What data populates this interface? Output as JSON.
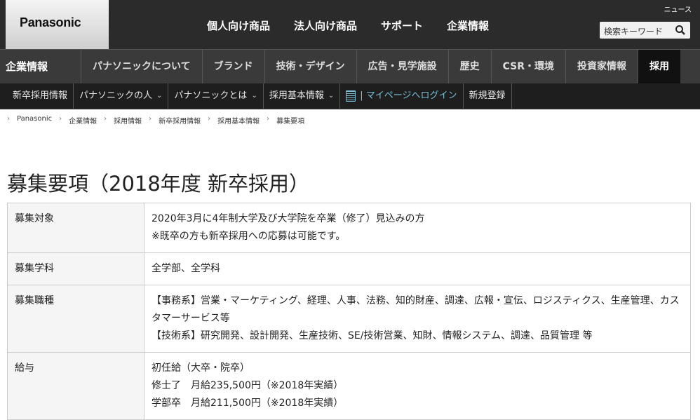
{
  "header": {
    "brand": "Panasonic",
    "news": "ニュース",
    "nav": [
      "個人向け商品",
      "法人向け商品",
      "サポート",
      "企業情報"
    ],
    "search_placeholder": "検索キーワード"
  },
  "secondary_nav": {
    "title": "企業情報",
    "items": [
      "パナソニックについて",
      "ブランド",
      "技術・デザイン",
      "広告・見学施設",
      "歴史",
      "CSR・環境",
      "投資家情報",
      "採用"
    ]
  },
  "tertiary_nav": {
    "items": [
      "新卒採用情報",
      "パナソニックの人",
      "パナソニックとは",
      "採用基本情報",
      "| マイページへログイン",
      "新規登録"
    ]
  },
  "breadcrumb": [
    "Panasonic",
    "企業情報",
    "採用情報",
    "新卒採用情報",
    "採用基本情報",
    "募集要項"
  ],
  "page_title": "募集要項（2018年度 新卒採用）",
  "table": [
    {
      "label": "募集対象",
      "lines": [
        "2020年3月に4年制大学及び大学院を卒業（修了）見込みの方",
        "※既卒の方も新卒採用への応募は可能です。"
      ]
    },
    {
      "label": "募集学科",
      "lines": [
        "全学部、全学科"
      ]
    },
    {
      "label": "募集職種",
      "lines": [
        "【事務系】営業・マーケティング、経理、人事、法務、知的財産、調達、広報・宣伝、ロジスティクス、生産管理、カスタマーサービス等",
        "【技術系】研究開発、設計開発、生産技術、SE/技術営業、知財、情報システム、調達、品質管理 等"
      ]
    },
    {
      "label": "給与",
      "lines": [
        "初任給（大卒・院卒）",
        "修士了　月給235,500円（※2018年実績）",
        "学部卒　月給211,500円（※2018年実績）"
      ]
    }
  ]
}
